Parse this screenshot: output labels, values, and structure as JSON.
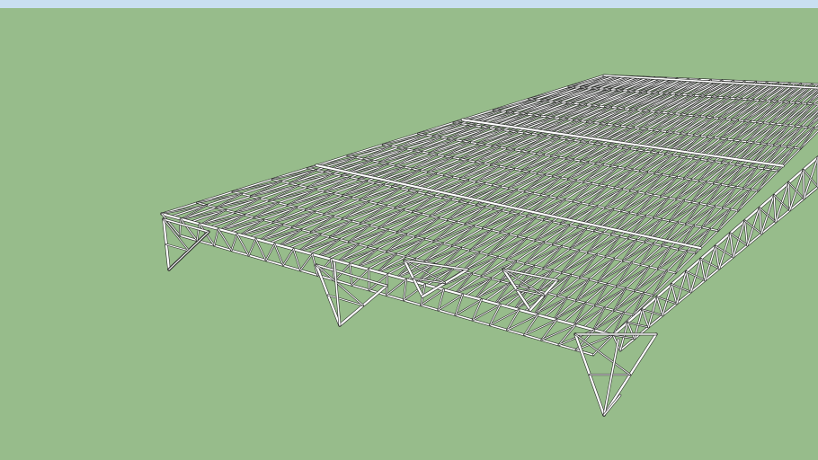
{
  "scene": {
    "sky_color": "#c9dff1",
    "sky_edge_color": "#a9c9e6",
    "ground_color": "#97bc8b",
    "model_name": "space-truss-roof-structure",
    "truss_member_color": "#ffffff",
    "truss_edge_color": "#2b2b2b"
  }
}
